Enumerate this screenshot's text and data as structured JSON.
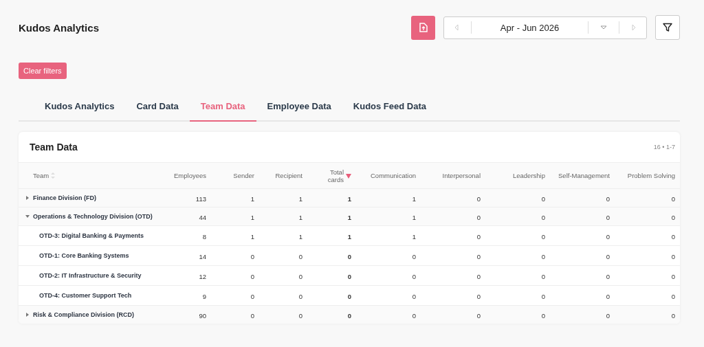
{
  "header": {
    "title": "Kudos Analytics",
    "period": "Apr - Jun 2026"
  },
  "clear_filters": "Clear filters",
  "tabs": [
    {
      "label": "Kudos Analytics",
      "selected": false
    },
    {
      "label": "Card Data",
      "selected": false
    },
    {
      "label": "Team Data",
      "selected": true
    },
    {
      "label": "Employee Data",
      "selected": false
    },
    {
      "label": "Kudos Feed Data",
      "selected": false
    }
  ],
  "table": {
    "title": "Team Data",
    "count": "16 • 1-7",
    "columns": [
      {
        "label": "Team",
        "sortable": true,
        "sorted": false,
        "bold": false
      },
      {
        "label": "Employees",
        "sortable": false,
        "sorted": false,
        "bold": false
      },
      {
        "label": "Sender",
        "sortable": false,
        "sorted": false,
        "bold": false
      },
      {
        "label": "Recipient",
        "sortable": false,
        "sorted": false,
        "bold": false
      },
      {
        "label": "Total cards",
        "sortable": true,
        "sorted": true,
        "bold": true
      },
      {
        "label": "Communication",
        "sortable": false,
        "sorted": false,
        "bold": false
      },
      {
        "label": "Interpersonal",
        "sortable": false,
        "sorted": false,
        "bold": false
      },
      {
        "label": "Leadership",
        "sortable": false,
        "sorted": false,
        "bold": false
      },
      {
        "label": "Self-Management",
        "sortable": false,
        "sorted": false,
        "bold": false
      },
      {
        "label": "Problem Solving",
        "sortable": false,
        "sorted": false,
        "bold": false
      }
    ],
    "rows": [
      {
        "team": "Finance Division (FD)",
        "expanded": false,
        "values": [
          "113",
          "1",
          "1",
          "1",
          "1",
          "0",
          "0",
          "0",
          "0"
        ]
      },
      {
        "team": "Operations & Technology Division (OTD)",
        "expanded": true,
        "values": [
          "44",
          "1",
          "1",
          "1",
          "1",
          "0",
          "0",
          "0",
          "0"
        ],
        "children": [
          {
            "team": "OTD-3: Digital Banking & Payments",
            "values": [
              "8",
              "1",
              "1",
              "1",
              "1",
              "0",
              "0",
              "0",
              "0"
            ]
          },
          {
            "team": "OTD-1: Core Banking Systems",
            "values": [
              "14",
              "0",
              "0",
              "0",
              "0",
              "0",
              "0",
              "0",
              "0"
            ]
          },
          {
            "team": "OTD-2: IT Infrastructure & Security",
            "values": [
              "12",
              "0",
              "0",
              "0",
              "0",
              "0",
              "0",
              "0",
              "0"
            ]
          },
          {
            "team": "OTD-4: Customer Support Tech",
            "values": [
              "9",
              "0",
              "0",
              "0",
              "0",
              "0",
              "0",
              "0",
              "0"
            ]
          }
        ]
      },
      {
        "team": "Risk & Compliance Division (RCD)",
        "expanded": false,
        "values": [
          "90",
          "0",
          "0",
          "0",
          "0",
          "0",
          "0",
          "0",
          "0"
        ]
      }
    ]
  }
}
